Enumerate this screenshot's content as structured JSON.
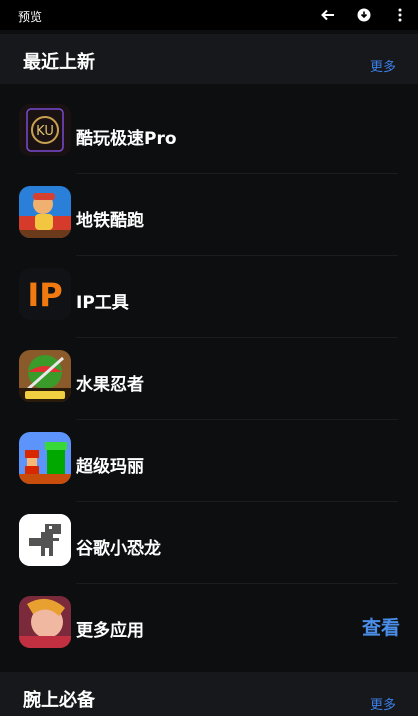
{
  "topbar": {
    "title": "预览",
    "icons": [
      "back-arrow-icon",
      "download-icon",
      "more-vertical-icon"
    ]
  },
  "sections": [
    {
      "title": "最近上新",
      "more": "更多"
    },
    {
      "title": "腕上必备",
      "more": "更多"
    }
  ],
  "apps": [
    {
      "name": "酷玩极速Pro",
      "icon": "kuwan-logo-icon",
      "icon_text": "KU"
    },
    {
      "name": "地铁酷跑",
      "icon": "subway-surfers-icon"
    },
    {
      "name": "IP工具",
      "icon": "ip-tool-icon",
      "icon_text": "IP"
    },
    {
      "name": "水果忍者",
      "icon": "fruit-ninja-icon"
    },
    {
      "name": "超级玛丽",
      "icon": "super-mario-icon"
    },
    {
      "name": "谷歌小恐龙",
      "icon": "chrome-dino-icon"
    },
    {
      "name": "更多应用",
      "icon": "more-apps-icon",
      "action": "查看"
    }
  ],
  "colors": {
    "background": "#0d0e10",
    "section_header": "#16181b",
    "accent": "#3d7fe8"
  }
}
